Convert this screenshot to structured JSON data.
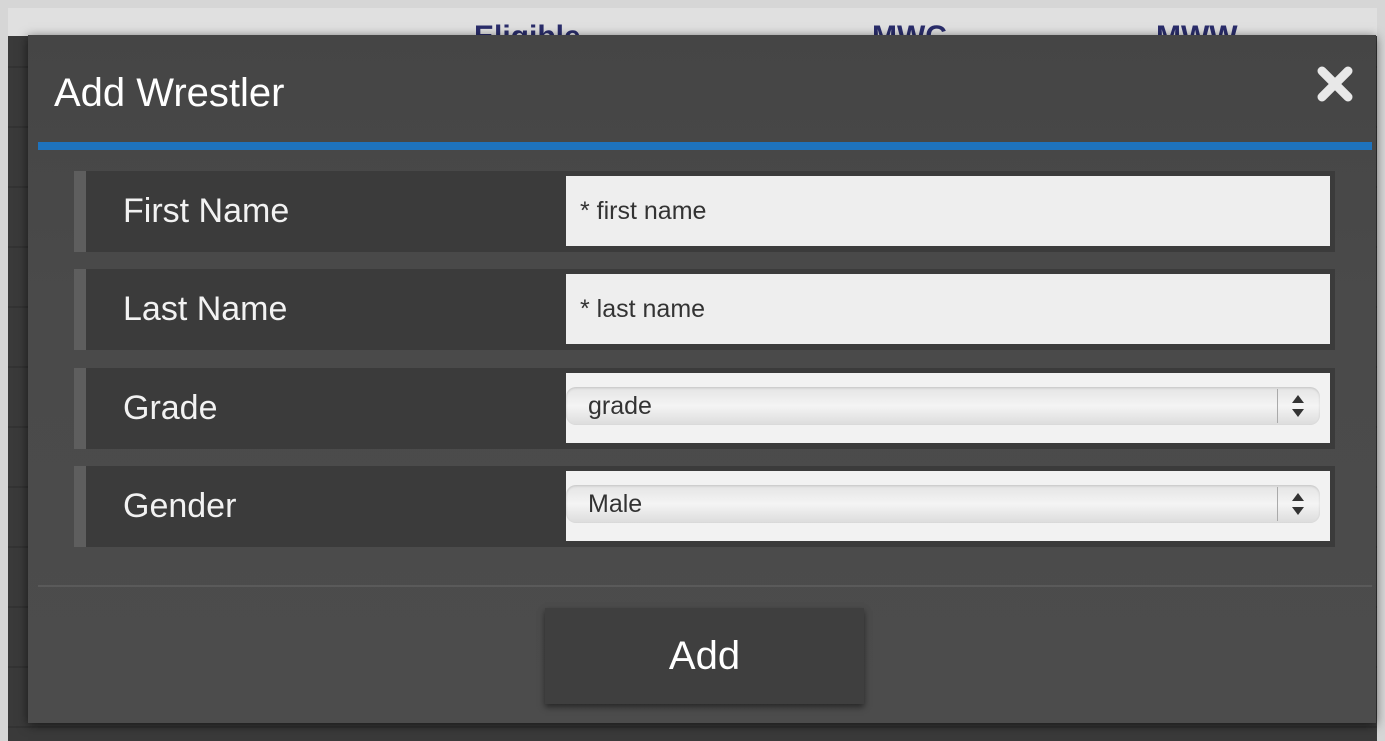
{
  "background": {
    "columns": [
      "Eligible",
      "MWC",
      "MWW"
    ]
  },
  "modal": {
    "title": "Add Wrestler",
    "close_icon": "close-icon",
    "accent_color": "#1e73be",
    "fields": {
      "first_name": {
        "label": "First Name",
        "placeholder": "* first name",
        "value": ""
      },
      "last_name": {
        "label": "Last Name",
        "placeholder": "* last name",
        "value": ""
      },
      "grade": {
        "label": "Grade",
        "selected": "grade"
      },
      "gender": {
        "label": "Gender",
        "selected": "Male"
      }
    },
    "add_label": "Add"
  }
}
